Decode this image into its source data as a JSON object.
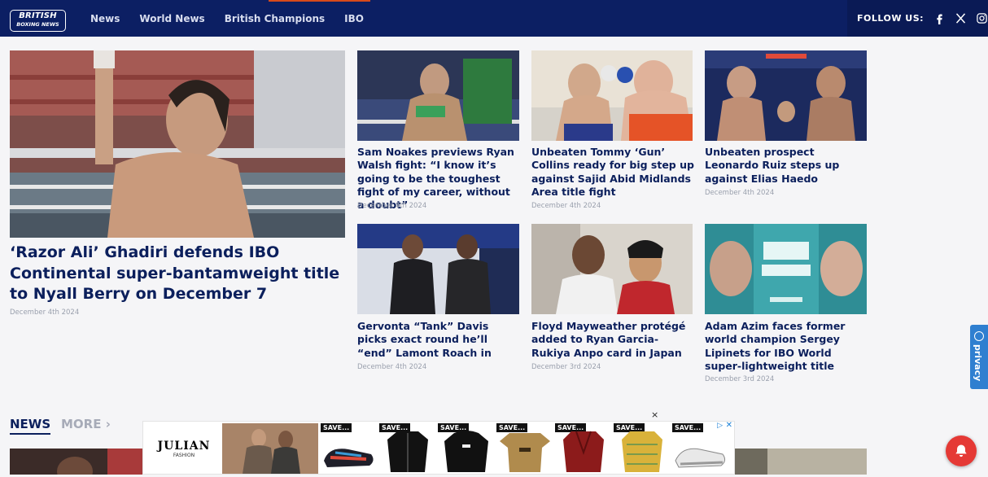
{
  "header": {
    "logo_line1": "BRITISH",
    "logo_line2": "BOXING NEWS",
    "nav": [
      "News",
      "World News",
      "British Champions",
      "IBO"
    ],
    "follow_label": "FOLLOW US:",
    "social": [
      "facebook-icon",
      "x-icon",
      "instagram-icon"
    ]
  },
  "featured": {
    "title": "‘Razor Ali’ Ghadiri defends IBO Continental super-bantamweight title to Nyall Berry on December 7",
    "date": "December 4th 2024"
  },
  "articles": [
    {
      "title": "Sam Noakes previews Ryan Walsh fight: “I know it’s going to be the toughest fight of my career, without a doubt”",
      "date": "December 4th 2024"
    },
    {
      "title": "Unbeaten Tommy ‘Gun’ Collins ready for big step up against Sajid Abid Midlands Area title fight",
      "date": "December 4th 2024"
    },
    {
      "title": "Unbeaten prospect Leonardo Ruiz steps up against Elias Haedo",
      "date": "December 4th 2024"
    },
    {
      "title": "Gervonta “Tank” Davis picks exact round he’ll “end” Lamont Roach in",
      "date": "December 4th 2024"
    },
    {
      "title": "Floyd Mayweather protégé added to Ryan Garcia-Rukiya Anpo card in Japan",
      "date": "December 3rd 2024"
    },
    {
      "title": "Adam Azim faces former world champion Sergey Lipinets for IBO World super-lightweight title",
      "date": "December 3rd 2024"
    }
  ],
  "sections": {
    "news": "NEWS",
    "more": "MORE ›"
  },
  "ad": {
    "brand": "JULIAN",
    "brand_sub": "FASHION",
    "save_tag": "SAVE...",
    "close": "×",
    "choices": "▷",
    "x": "✕"
  },
  "privacy_label": "privacy",
  "colors": {
    "header": "#0c1f63",
    "title": "#0b1f5c",
    "accent": "#2f7fd0",
    "bell": "#e53935"
  }
}
